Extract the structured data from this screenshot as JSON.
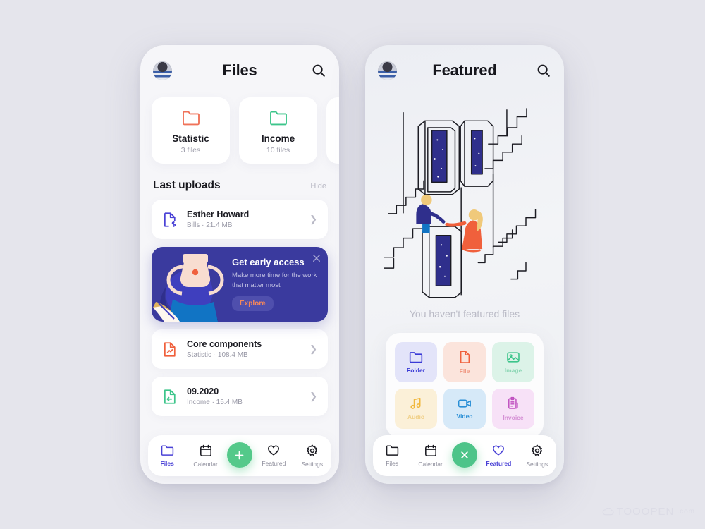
{
  "background_color": "#e5e5ec",
  "left_phone": {
    "header": {
      "title": "Files",
      "avatar_name": "user-avatar",
      "search_icon": "search-icon"
    },
    "folder_cards": [
      {
        "name": "Statistic",
        "count": "3 files",
        "color": "#f0735a",
        "icon": "folder-icon"
      },
      {
        "name": "Income",
        "count": "10 files",
        "color": "#3dc58b",
        "icon": "folder-icon"
      },
      {
        "name": "",
        "count": "",
        "color": "#8c8cf0",
        "icon": "folder-icon"
      }
    ],
    "section": {
      "title": "Last uploads",
      "hide_label": "Hide"
    },
    "uploads": [
      {
        "name": "Esther Howard",
        "meta": "Bills · 21.4 MB",
        "icon": "document-dollar-icon",
        "color": "#4a42d6"
      },
      {
        "name": "Core components",
        "meta": "Statistic · 108.4 MB",
        "icon": "document-chart-icon",
        "color": "#f0603c"
      },
      {
        "name": "09.2020",
        "meta": "Income · 15.4 MB",
        "icon": "document-import-icon",
        "color": "#3dc58b"
      }
    ],
    "promo": {
      "title": "Get early access",
      "subtitle": "Make more time for the work that matter most",
      "cta_label": "Explore",
      "close_icon": "close-icon",
      "bg_color": "#3a3a9e",
      "cta_text_color": "#f4875a"
    },
    "nav": {
      "items": [
        {
          "label": "Files",
          "icon": "folder-icon",
          "active": true
        },
        {
          "label": "Calendar",
          "icon": "calendar-icon",
          "active": false
        },
        {
          "label": "Featured",
          "icon": "heart-icon",
          "active": false
        },
        {
          "label": "Settings",
          "icon": "gear-icon",
          "active": false
        }
      ],
      "fab": {
        "icon": "plus-icon",
        "color": "#54c98a"
      }
    }
  },
  "right_phone": {
    "header": {
      "title": "Featured",
      "avatar_name": "user-avatar",
      "search_icon": "search-icon"
    },
    "illustration": "doors-and-stairs-illustration",
    "empty_text": "You haven't featured files",
    "file_types": [
      {
        "label": "Folder",
        "icon": "folder-icon",
        "bg": "#e3e4f9",
        "fg": "#3a3ad6"
      },
      {
        "label": "File",
        "icon": "file-icon",
        "bg": "#fbe4dc",
        "fg": "#f0603c"
      },
      {
        "label": "Image",
        "icon": "image-icon",
        "bg": "#dcf3e8",
        "fg": "#3dc58b"
      },
      {
        "label": "Audio",
        "icon": "music-icon",
        "bg": "#fbf0d8",
        "fg": "#f0b73c"
      },
      {
        "label": "Video",
        "icon": "video-icon",
        "bg": "#d6e9f8",
        "fg": "#2a8fd6"
      },
      {
        "label": "Invoice",
        "icon": "invoice-icon",
        "bg": "#f7e1f7",
        "fg": "#c050c0"
      }
    ],
    "nav": {
      "items": [
        {
          "label": "Files",
          "icon": "folder-icon",
          "active": false
        },
        {
          "label": "Calendar",
          "icon": "calendar-icon",
          "active": false
        },
        {
          "label": "Featured",
          "icon": "heart-icon",
          "active": true
        },
        {
          "label": "Settings",
          "icon": "gear-icon",
          "active": false
        }
      ],
      "fab": {
        "icon": "close-icon",
        "color": "#4dc489"
      }
    }
  },
  "watermark": {
    "main": "TOOOPEN",
    "suffix": ".com"
  }
}
